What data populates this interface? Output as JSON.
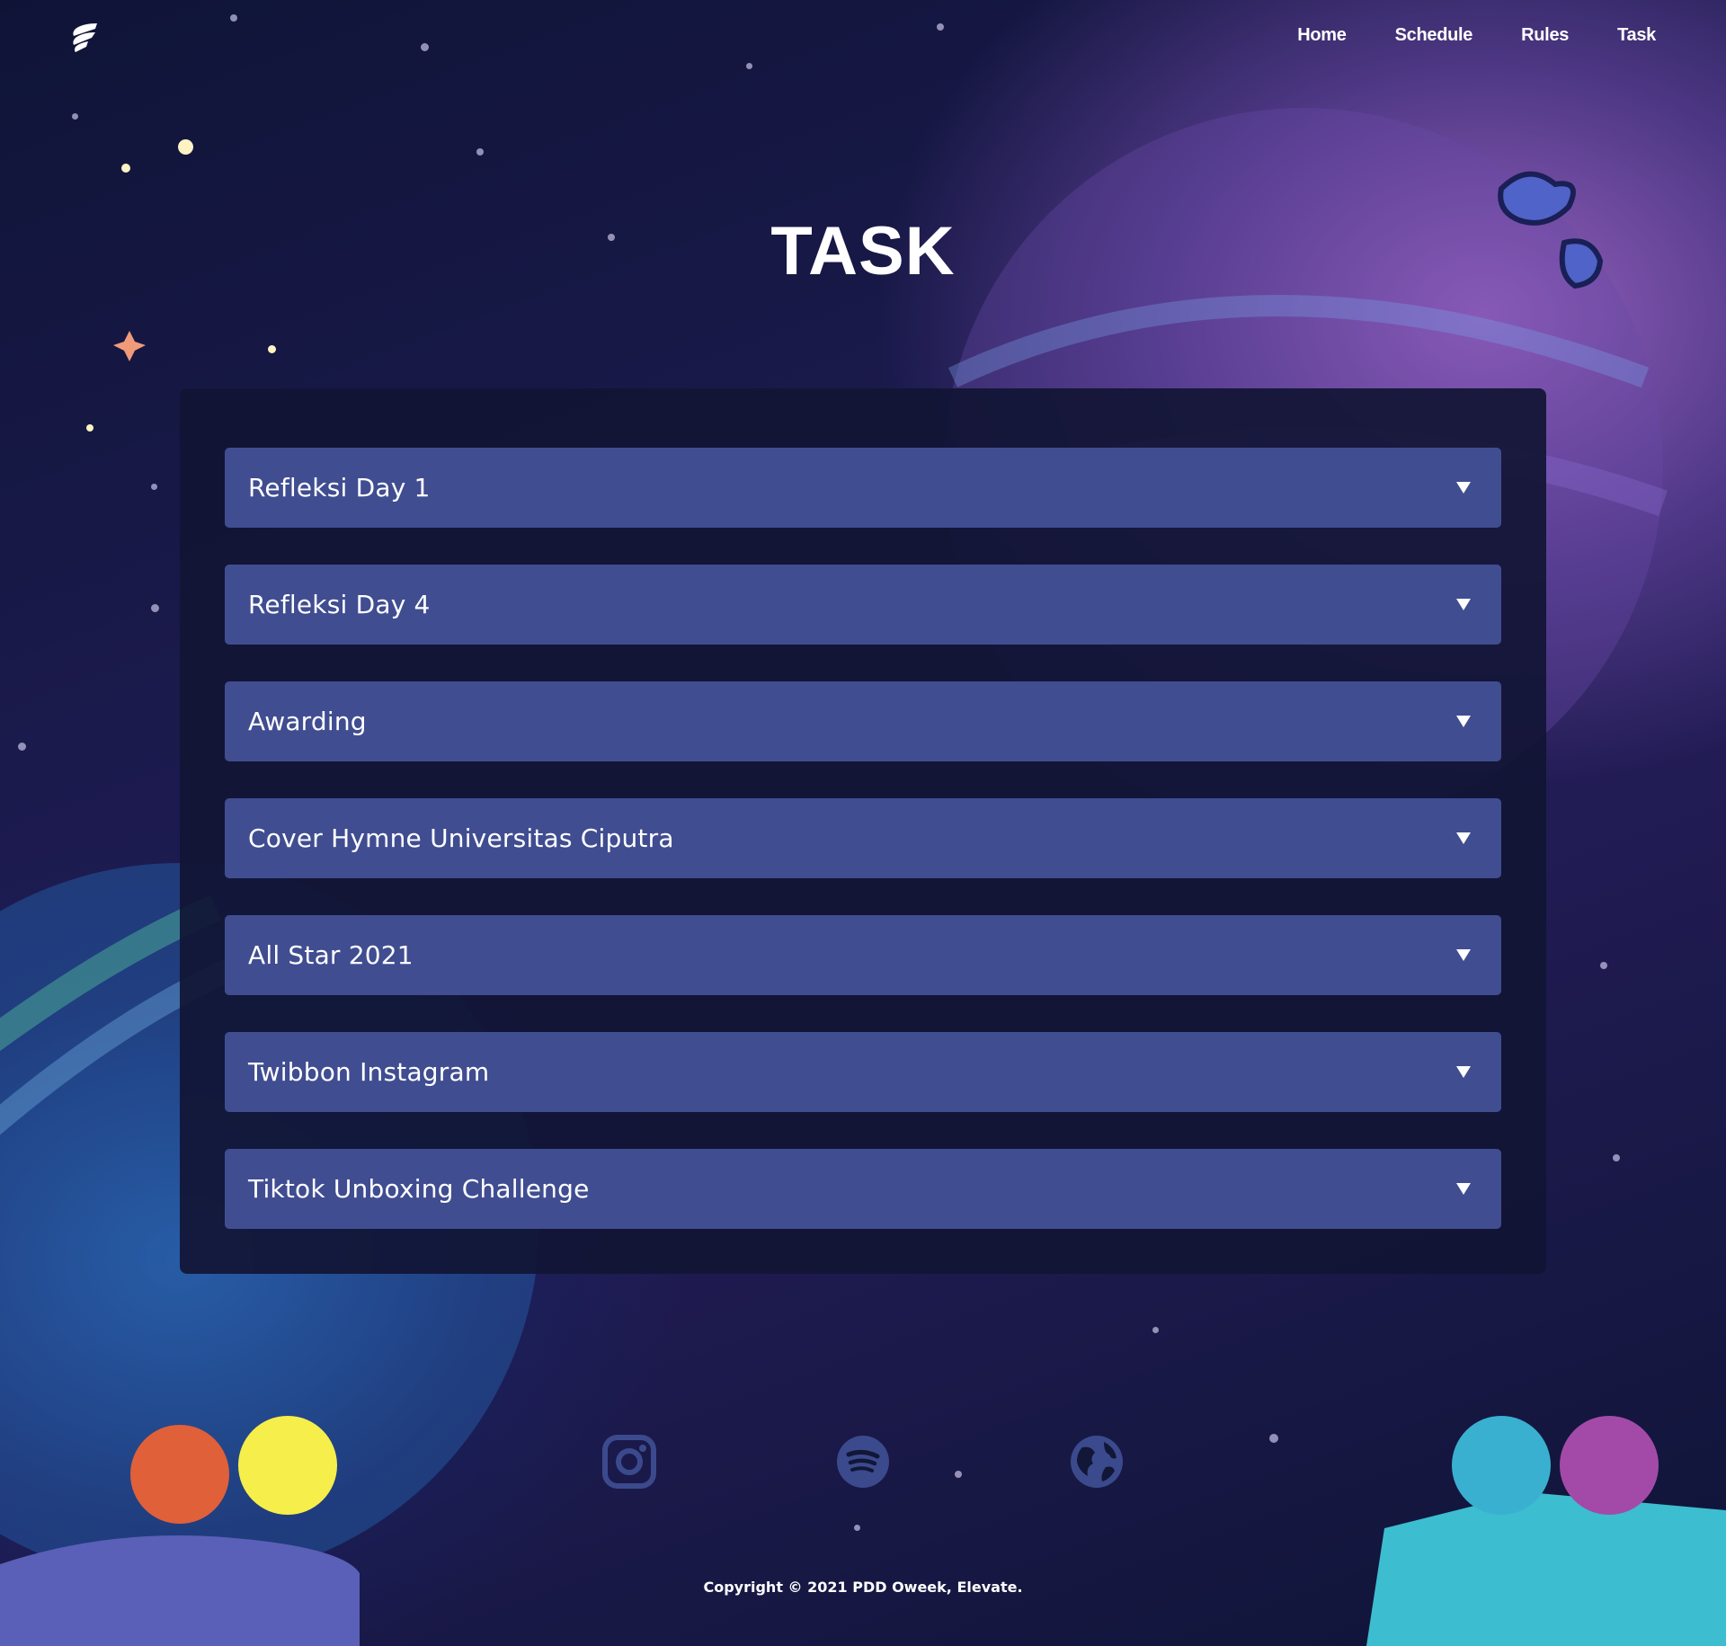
{
  "nav": {
    "logo_icon": "feather-logo-icon",
    "items": [
      "Home",
      "Schedule",
      "Rules",
      "Task"
    ]
  },
  "page": {
    "title": "TASK"
  },
  "tasks": [
    {
      "label": "Refleksi Day 1",
      "icon": "triangle-down-icon"
    },
    {
      "label": "Refleksi Day 4",
      "icon": "triangle-down-icon"
    },
    {
      "label": "Awarding",
      "icon": "triangle-down-icon"
    },
    {
      "label": "Cover Hymne Universitas Ciputra",
      "icon": "triangle-down-icon"
    },
    {
      "label": "All Star 2021",
      "icon": "triangle-down-icon"
    },
    {
      "label": "Twibbon Instagram",
      "icon": "triangle-down-icon"
    },
    {
      "label": "Tiktok Unboxing Challenge",
      "icon": "triangle-down-icon"
    }
  ],
  "footer": {
    "socials": [
      "instagram-icon",
      "spotify-icon",
      "globe-icon"
    ],
    "copyright": "Copyright © 2021 PDD Oweek, Elevate."
  },
  "colors": {
    "accordion": "#404d91",
    "panel": "#111534",
    "social_icon": "#3b4a8c"
  }
}
